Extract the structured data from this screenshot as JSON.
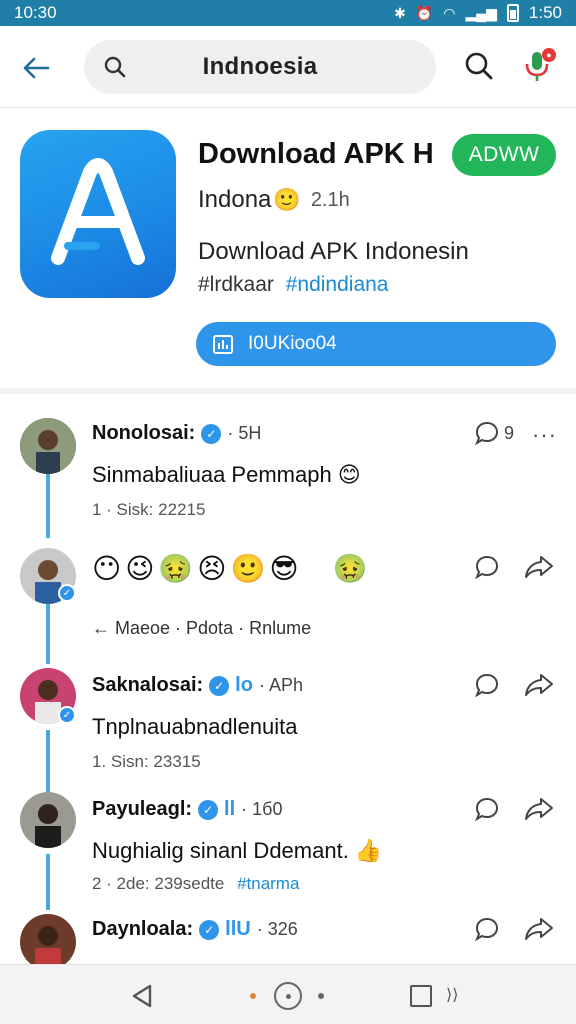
{
  "status_bar": {
    "time_left": "10:30",
    "time_right": "1:50"
  },
  "search": {
    "query": "Indnoesia"
  },
  "app": {
    "title": "Download APK H",
    "install_label": "ADWW",
    "developer": "Indona",
    "developer_emoji": "🙂",
    "meta": "2.1h",
    "description": "Download APK Indonesin",
    "tag_plain": "#lrdkaar",
    "tag_link": "#ndindiana",
    "download_label": "I0UKioo04"
  },
  "posts": [
    {
      "name": "Nonolosai:",
      "verified_text": "",
      "time": "· 5H",
      "text": "Sinmabaliuaa Pemmaph 😊",
      "meta": "1 · Sisk: 22215",
      "meta_link": "",
      "comment_count": "9"
    },
    {
      "emojis": [
        "😶",
        "😉",
        "🤢",
        "😣",
        "🙂",
        "😎",
        "🤢"
      ],
      "reply": "← Maeoe · Pdota · Rnlume"
    },
    {
      "name": "Saknalosai:",
      "verified_text": "lo",
      "time": "· APh",
      "text": "Tnplnauabnadlenuita",
      "meta": "1. Sisn: 23315",
      "meta_link": ""
    },
    {
      "name": "Payuleagl:",
      "verified_text": "ll",
      "time": "· 1б0",
      "text": "Nughialig sinanl Ddemant. 👍",
      "meta": "2 · 2de: 239sedte",
      "meta_link": "#tnarma"
    },
    {
      "name": "Daynloala:",
      "verified_text": "llU",
      "time": "· 326",
      "text": "",
      "meta": "",
      "meta_link": ""
    }
  ],
  "icons": {
    "accent": "#2f95ea",
    "install_green": "#22b55a",
    "statusbar": "#1f7fa6"
  }
}
